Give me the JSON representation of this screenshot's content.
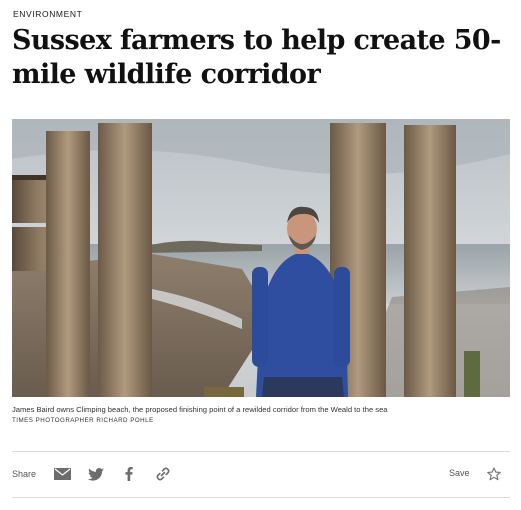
{
  "article": {
    "section": "ENVIRONMENT",
    "headline": "Sussex farmers to help create 50-mile wildlife corridor",
    "image": {
      "caption": "James Baird owns Climping beach, the proposed finishing point of a rewilded corridor from the Weald to the sea",
      "credit": "TIMES PHOTOGRAPHER RICHARD POHLE"
    }
  },
  "toolbar": {
    "share_label": "Share",
    "save_label": "Save",
    "icons": [
      "email-icon",
      "twitter-icon",
      "facebook-icon",
      "link-icon",
      "star-icon"
    ]
  }
}
